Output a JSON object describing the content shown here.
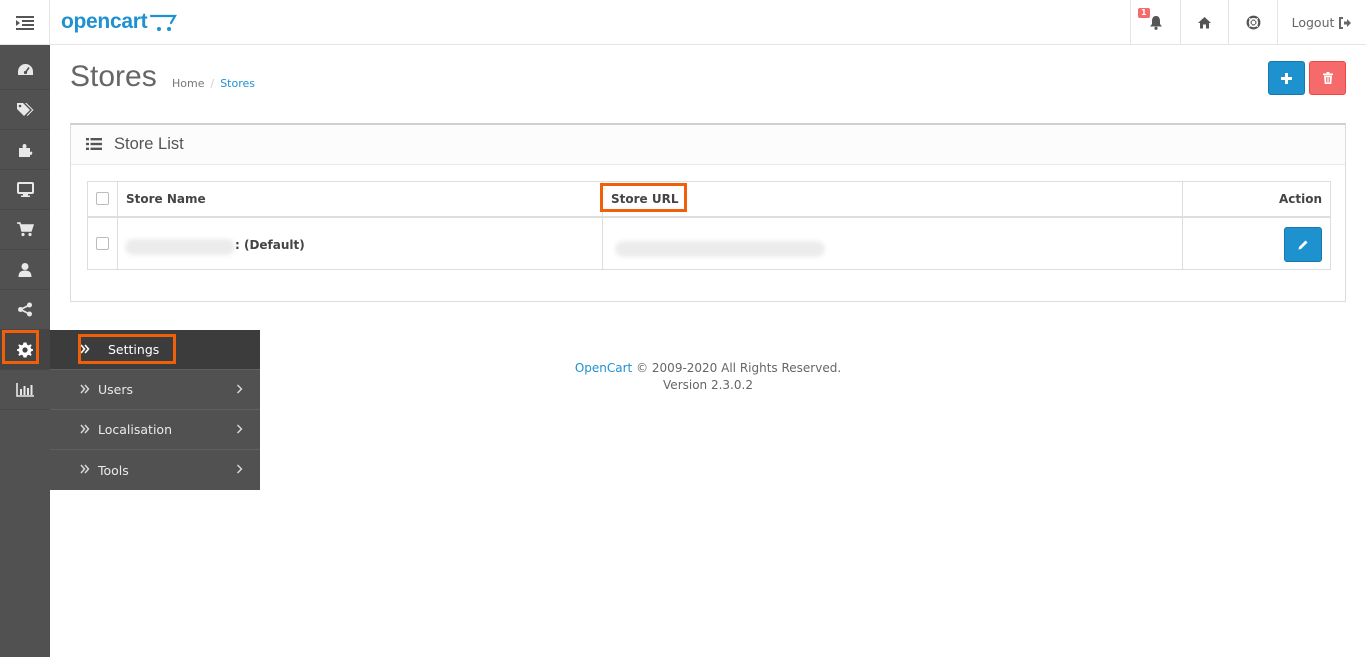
{
  "header": {
    "logo": "opencart",
    "notification_count": "1",
    "logout_label": "Logout"
  },
  "sidebar": {
    "icons": [
      "dashboard-icon",
      "tags-icon",
      "puzzle-icon",
      "desktop-icon",
      "cart-icon",
      "user-icon",
      "share-icon",
      "gear-icon",
      "bar-chart-icon"
    ],
    "active": "gear-icon"
  },
  "flyout": {
    "items": [
      {
        "label": "Settings",
        "has_submenu": false,
        "active": true
      },
      {
        "label": "Users",
        "has_submenu": true
      },
      {
        "label": "Localisation",
        "has_submenu": true
      },
      {
        "label": "Tools",
        "has_submenu": true
      }
    ]
  },
  "page": {
    "title": "Stores",
    "breadcrumb": {
      "home": "Home",
      "separator": "/",
      "current": "Stores"
    }
  },
  "panel": {
    "title": "Store List",
    "columns": {
      "name": "Store Name",
      "url": "Store URL",
      "action": "Action"
    },
    "rows": [
      {
        "name_suffix": ": (Default)"
      }
    ]
  },
  "footer": {
    "link": "OpenCart",
    "copyright": "© 2009-2020 All Rights Reserved.",
    "version": "Version 2.3.0.2"
  },
  "colors": {
    "primary": "#1e91cf",
    "danger": "#f56b6b",
    "sidebar": "#515151",
    "highlight": "#f0600a"
  }
}
